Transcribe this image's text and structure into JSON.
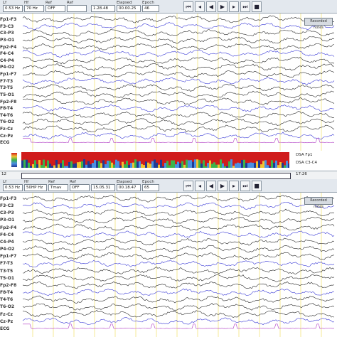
{
  "top_toolbar": {
    "fields": [
      {
        "label": "Lf",
        "value": "0.53 Hz"
      },
      {
        "label": "Hf",
        "value": "70 Hz"
      },
      {
        "label": "Ref",
        "value": "OFF"
      },
      {
        "label": "Ref",
        "value": ""
      },
      {
        "label": "",
        "value": "1.28.48"
      },
      {
        "label": "Elapsed",
        "value": "00.00.25"
      },
      {
        "label": "Epoch",
        "value": "46"
      }
    ],
    "fft_button": "Recorded notes"
  },
  "bottom_toolbar": {
    "fields": [
      {
        "label": "Lf",
        "value": "0.53 Hz"
      },
      {
        "label": "Hf",
        "value": "50HP Hz"
      },
      {
        "label": "Ref",
        "value": "Tmav"
      },
      {
        "label": "Ref",
        "value": "OFF"
      },
      {
        "label": "",
        "value": "15.05.31"
      },
      {
        "label": "Elapsed",
        "value": "00.18.47"
      },
      {
        "label": "Epoch",
        "value": "65"
      }
    ],
    "fft_button": "Recorded notes"
  },
  "toolbar_icons": [
    "rewind-icon",
    "back-icon",
    "play-back-icon",
    "play-icon",
    "forward-icon",
    "fast-forward-icon",
    "stop-icon"
  ],
  "top_channels": [
    "Fp1-F3",
    "F3-C3",
    "C3-P3",
    "P3-O1",
    "Fp2-F4",
    "F4-C4",
    "C4-P4",
    "P4-O2",
    "Fp1-F7",
    "F7-T3",
    "T3-T5",
    "T5-O1",
    "Fp2-F8",
    "F8-T4",
    "T4-T6",
    "T6-O2",
    "Fz-Cz",
    "Cz-Pz",
    "ECG"
  ],
  "bottom_channels": [
    "Fp1-F3",
    "F3-C3",
    "C3-P3",
    "P3-O1",
    "Fp2-F4",
    "F4-C4",
    "C4-P4",
    "P4-O2",
    "Fp1-F7",
    "F7-T3",
    "T3-T5",
    "T5-O1",
    "Fp2-F8",
    "F8-T4",
    "T4-T6",
    "T6-O2",
    "Fz-Cz",
    "Cz-Pz",
    "ECG"
  ],
  "spectrogram": {
    "channel_a": "DSA Fp1",
    "channel_b": "DSA C3-C4",
    "left_time": "12",
    "time_right": "17:26",
    "colors": {
      "high": "#d01c1c",
      "mid": "#f1c232",
      "low": "#1f3a93"
    }
  },
  "colors": {
    "trace": "#2a2a2a",
    "trace_blue": "#3b3bd6",
    "ecg": "#b03cc4",
    "gridline": "#f3e37a"
  }
}
